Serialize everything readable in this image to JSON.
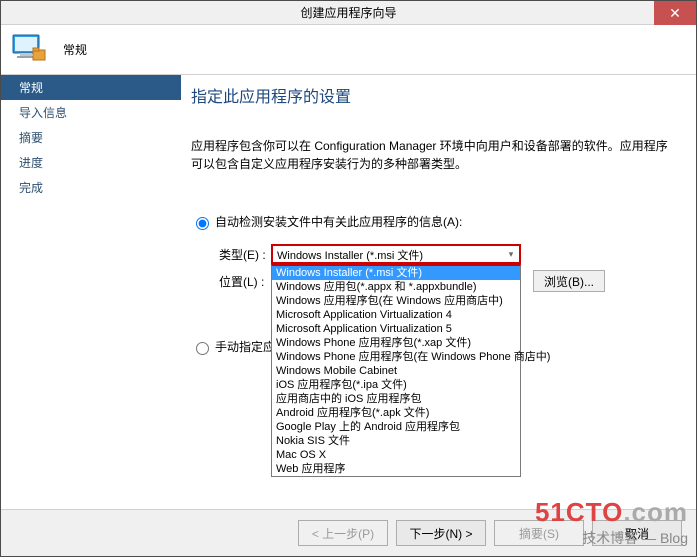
{
  "window": {
    "title": "创建应用程序向导",
    "close_glyph": "✕"
  },
  "header": {
    "title": "常规"
  },
  "sidebar": {
    "items": [
      {
        "label": "常规",
        "active": true
      },
      {
        "label": "导入信息",
        "active": false
      },
      {
        "label": "摘要",
        "active": false
      },
      {
        "label": "进度",
        "active": false
      },
      {
        "label": "完成",
        "active": false
      }
    ]
  },
  "page": {
    "title": "指定此应用程序的设置",
    "description": "应用程序包含你可以在 Configuration Manager 环境中向用户和设备部署的软件。应用程序可以包含自定义应用程序安装行为的多种部署类型。"
  },
  "radio": {
    "auto_label": "自动检测安装文件中有关此应用程序的信息(A):",
    "manual_label": "手动指定应用程序信息(M)"
  },
  "fields": {
    "type_label": "类型(E) :",
    "location_label": "位置(L) :",
    "browse_label": "浏览(B)..."
  },
  "combo": {
    "selected": "Windows Installer (*.msi 文件)",
    "options": [
      "Windows Installer (*.msi 文件)",
      "Windows 应用包(*.appx 和 *.appxbundle)",
      "Windows 应用程序包(在 Windows 应用商店中)",
      "Microsoft Application Virtualization 4",
      "Microsoft Application Virtualization 5",
      "Windows Phone 应用程序包(*.xap 文件)",
      "Windows Phone 应用程序包(在 Windows Phone 商店中)",
      "Windows Mobile Cabinet",
      "iOS 应用程序包(*.ipa 文件)",
      "应用商店中的 iOS 应用程序包",
      "Android 应用程序包(*.apk 文件)",
      "Google Play 上的 Android 应用程序包",
      "Nokia SIS 文件",
      "Mac OS X",
      "Web 应用程序"
    ]
  },
  "footer": {
    "prev": "< 上一步(P)",
    "next": "下一步(N) >",
    "summary": "摘要(S)",
    "cancel": "取消"
  },
  "watermark": {
    "line1a": "51CTO",
    "line1b": ".com",
    "line2": "技术博客 — Blog"
  }
}
